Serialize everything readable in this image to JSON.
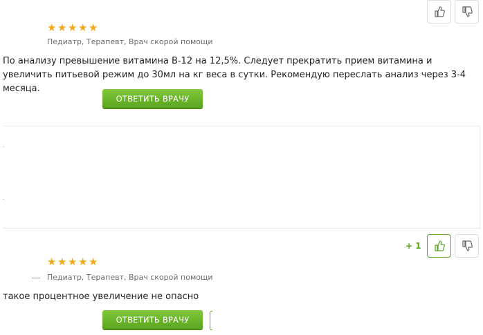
{
  "answers": [
    {
      "rating": 5,
      "specialization": "Педиатр, Терапевт, Врач скорой помощи",
      "text": "По анализу превышение витамина В-12 на 12,5%. Следует прекратить прием витамина и увеличить питьевой режим до 30мл на кг веса в сутки. Рекомендую переслать анализ через 3-4 месяца.",
      "reply_label": "Ответить врачу",
      "votes": {
        "score": ""
      }
    },
    {
      "rating": 5,
      "specialization": "Педиатр, Терапевт, Врач скорой помощи",
      "text": "такое процентное увеличение не опасно",
      "reply_label": "Ответить врачу",
      "votes": {
        "score": "+ 1"
      }
    }
  ],
  "icons": {
    "like": "thumbs-up-icon",
    "dislike": "thumbs-down-icon",
    "rating": "star-icon"
  },
  "colors": {
    "accent_green": "#5aa51f",
    "star_orange": "#f0a81c",
    "muted_text": "#6b6b6b"
  }
}
